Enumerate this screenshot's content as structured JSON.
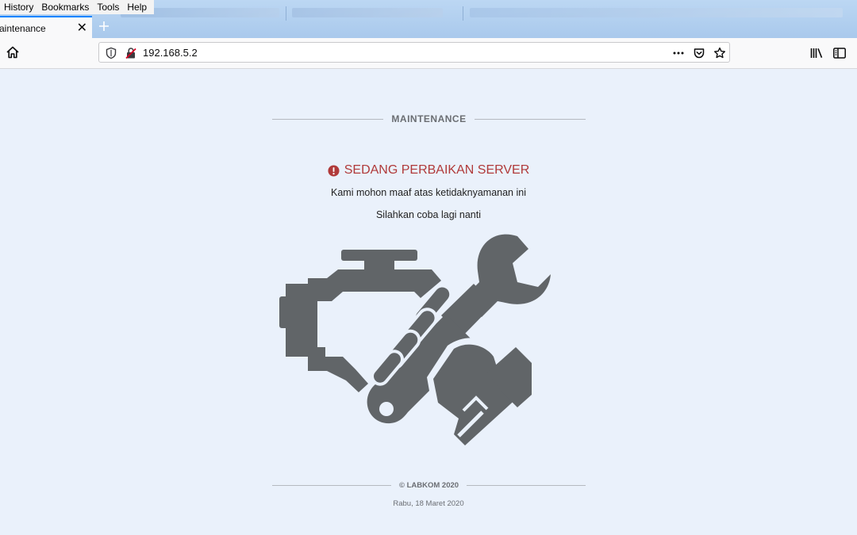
{
  "menubar": {
    "items": [
      "History",
      "Bookmarks",
      "Tools",
      "Help"
    ]
  },
  "tabs": {
    "active": {
      "title": "aintenance"
    }
  },
  "navbar": {
    "url": "192.168.5.2"
  },
  "page": {
    "heading": "MAINTENANCE",
    "alert_title": "SEDANG PERBAIKAN SERVER",
    "message_1": "Kami mohon maaf atas ketidaknyamanan ini",
    "message_2": "Silahkan coba lagi nanti",
    "copyright": "© LABKOM 2020",
    "date": "Rabu, 18 Maret 2020"
  },
  "icons": {
    "home": "home-icon",
    "shield": "tracking-protection-icon",
    "insecure": "insecure-connection-icon",
    "more": "more-actions-icon",
    "pocket": "pocket-icon",
    "bookmark": "bookmark-star-icon",
    "library": "library-icon",
    "sidebar": "sidebar-icon",
    "alert": "exclamation-circle-icon",
    "illustration": "engine-wrench-hand-icon"
  },
  "colors": {
    "page_background": "#eaf1fb",
    "alert_text": "#b03a3a",
    "illustration": "#616568",
    "tab_accent": "#0a84ff"
  }
}
